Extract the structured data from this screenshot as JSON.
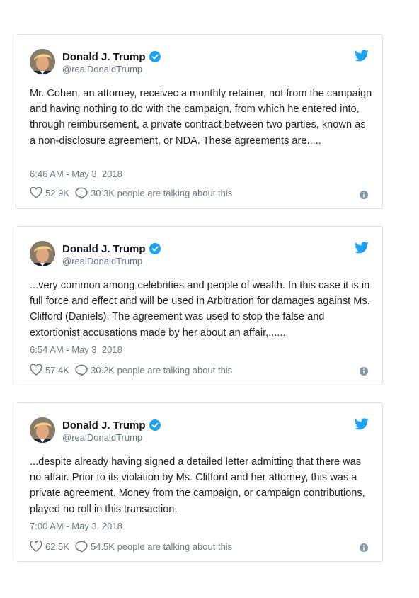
{
  "colors": {
    "twitter_blue": "#1da1f2",
    "text": "#1c2022",
    "muted": "#697882",
    "border": "#dcdfe3"
  },
  "tweets": [
    {
      "name": "Donald J. Trump",
      "handle": "@realDonaldTrump",
      "text": "Mr. Cohen, an attorney, receivec a monthly retainer, not from the campaign and having nothing to do with the campaign, from which he entered into, through reimbursement, a private contract between two parties, known as a non-disclosure agreement, or NDA. These agreements are.....",
      "timestamp": "6:46 AM - May 3, 2018",
      "likes": "52.9K",
      "talking": "30.3K people are talking about this"
    },
    {
      "name": "Donald J. Trump",
      "handle": "@realDonaldTrump",
      "text": "...very common among celebrities and people of wealth. In this case it is in full force and effect and will be used in Arbitration for damages against Ms. Clifford (Daniels). The agreement was used to stop the false and extortionist accusations made by her about an affair,......",
      "timestamp": "6:54 AM - May 3, 2018",
      "likes": "57.4K",
      "talking": "30.2K people are talking about this"
    },
    {
      "name": "Donald J. Trump",
      "handle": "@realDonaldTrump",
      "text": "...despite already having signed a detailed letter admitting that there was no affair. Prior to its violation by Ms. Clifford and her attorney, this was a private agreement. Money from the campaign, or campaign contributions, played no roll in this transaction.",
      "timestamp": "7:00 AM - May 3, 2018",
      "likes": "62.5K",
      "talking": "54.5K people are talking about this"
    }
  ]
}
